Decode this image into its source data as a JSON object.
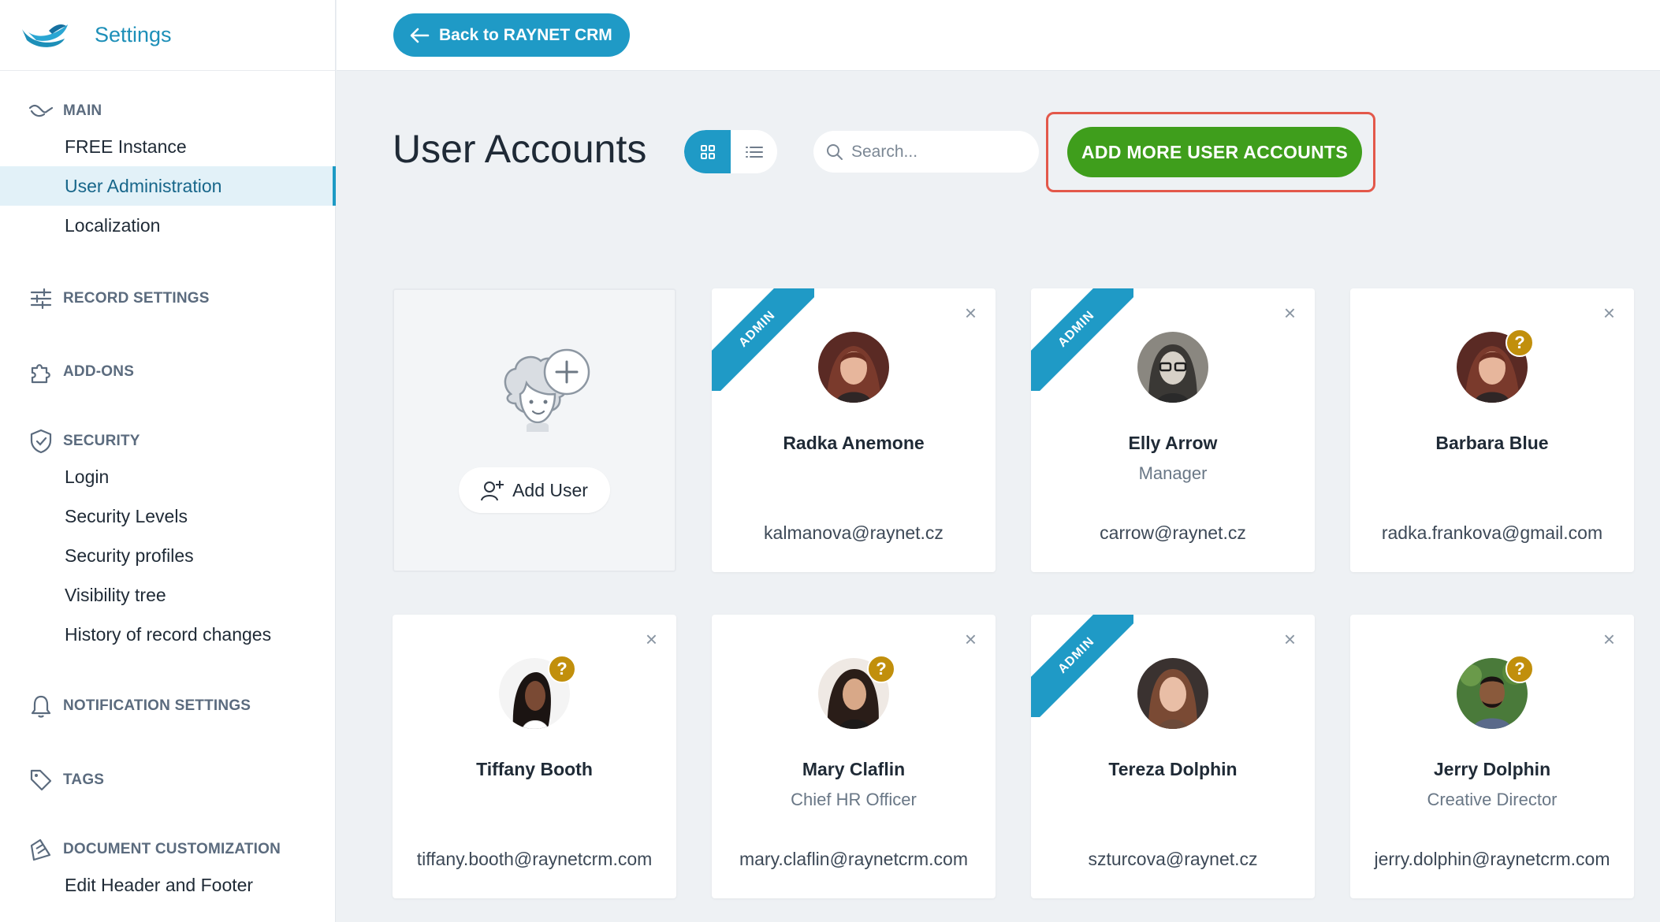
{
  "sidebar": {
    "title": "Settings",
    "sections": [
      {
        "label": "MAIN",
        "icon": "handshake-icon",
        "items": [
          "FREE Instance",
          "User Administration",
          "Localization"
        ]
      },
      {
        "label": "RECORD SETTINGS",
        "icon": "sliders-icon",
        "items": []
      },
      {
        "label": "ADD-ONS",
        "icon": "puzzle-icon",
        "items": []
      },
      {
        "label": "SECURITY",
        "icon": "shield-icon",
        "items": [
          "Login",
          "Security Levels",
          "Security profiles",
          "Visibility tree",
          "History of record changes"
        ]
      },
      {
        "label": "NOTIFICATION SETTINGS",
        "icon": "bell-icon",
        "items": []
      },
      {
        "label": "TAGS",
        "icon": "tag-icon",
        "items": []
      },
      {
        "label": "DOCUMENT CUSTOMIZATION",
        "icon": "document-icon",
        "items": [
          "Edit Header and Footer"
        ]
      }
    ],
    "active_item": "User Administration"
  },
  "topbar": {
    "back_label": "Back to RAYNET CRM"
  },
  "toolbar": {
    "title": "User Accounts",
    "search_placeholder": "Search...",
    "add_more_label": "ADD MORE USER ACCOUNTS"
  },
  "add_card": {
    "button_label": "Add User"
  },
  "users": [
    {
      "name": "Radka Anemone",
      "role": "",
      "email": "kalmanova@raynet.cz",
      "admin": true,
      "pending": false
    },
    {
      "name": "Elly Arrow",
      "role": "Manager",
      "email": "carrow@raynet.cz",
      "admin": true,
      "pending": false
    },
    {
      "name": "Barbara Blue",
      "role": "",
      "email": "radka.frankova@gmail.com",
      "admin": false,
      "pending": true
    },
    {
      "name": "Tiffany Booth",
      "role": "",
      "email": "tiffany.booth@raynetcrm.com",
      "admin": false,
      "pending": true
    },
    {
      "name": "Mary Claflin",
      "role": "Chief HR Officer",
      "email": "mary.claflin@raynetcrm.com",
      "admin": false,
      "pending": true
    },
    {
      "name": "Tereza Dolphin",
      "role": "",
      "email": "szturcova@raynet.cz",
      "admin": true,
      "pending": false
    },
    {
      "name": "Jerry Dolphin",
      "role": "Creative Director",
      "email": "jerry.dolphin@raynetcrm.com",
      "admin": false,
      "pending": true
    }
  ],
  "labels": {
    "admin_ribbon": "ADMIN",
    "pending_badge": "?",
    "close": "×"
  },
  "colors": {
    "accent": "#1f9ac6",
    "add_more_button": "#3f9e1c",
    "highlight_border": "#e3584a",
    "pending_badge": "#c18f0c"
  }
}
